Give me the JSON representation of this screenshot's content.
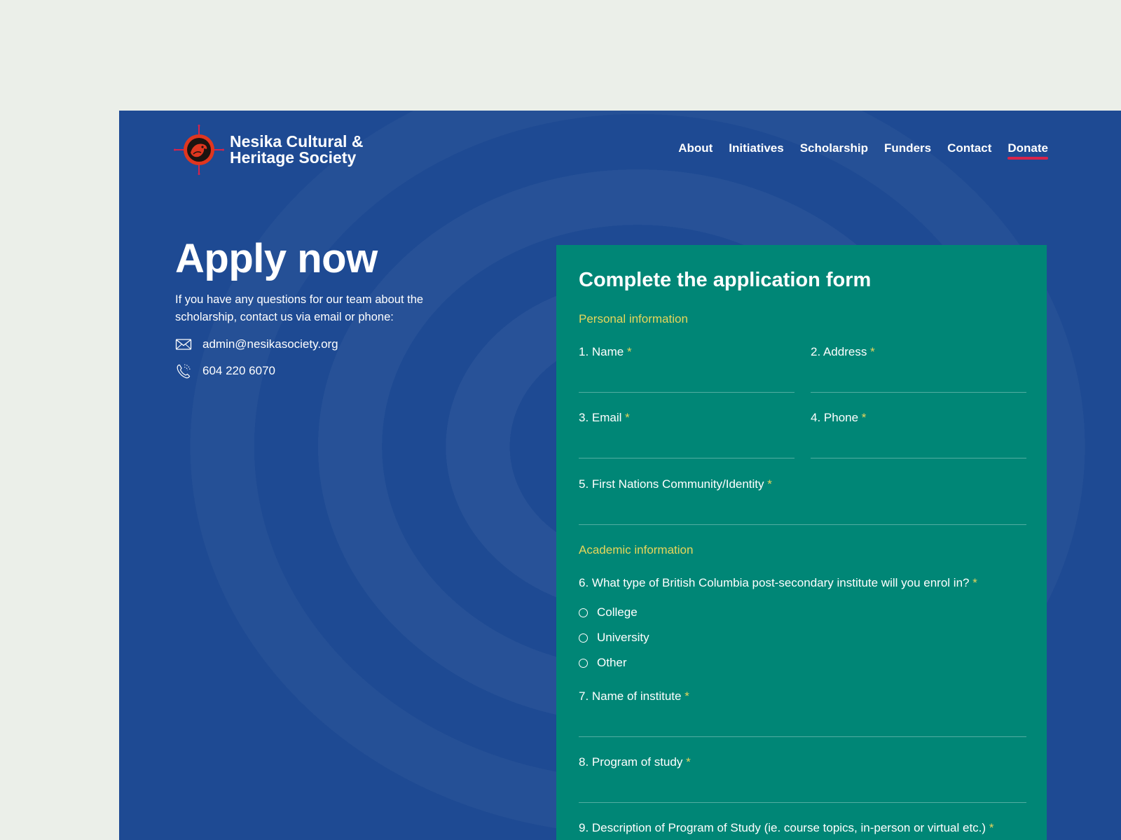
{
  "brand": {
    "name_line1": "Nesika Cultural &",
    "name_line2": "Heritage Society"
  },
  "nav": {
    "items": [
      {
        "label": "About"
      },
      {
        "label": "Initiatives"
      },
      {
        "label": "Scholarship"
      },
      {
        "label": "Funders"
      },
      {
        "label": "Contact"
      },
      {
        "label": "Donate",
        "active": true
      }
    ]
  },
  "hero": {
    "title": "Apply now",
    "intro": "If you have any questions for our team about the scholarship, contact us via email or phone:",
    "email": "admin@nesikasociety.org",
    "phone": "604 220 6070"
  },
  "form": {
    "title": "Complete the application form",
    "required_marker": "*",
    "personal_section": "Personal information",
    "academic_section": "Academic information",
    "fields": {
      "name": "1. Name",
      "address": "2. Address",
      "email": "3. Email",
      "phone": "4. Phone",
      "community": "5. First Nations Community/Identity",
      "institute_type": "6. What type of British Columbia post-secondary institute will you enrol in?",
      "institute_name": "7. Name of institute",
      "program": "8. Program of study",
      "description": "9. Description of Program of Study (ie. course topics, in-person or virtual etc.)"
    },
    "institute_options": [
      "College",
      "University",
      "Other"
    ]
  },
  "colors": {
    "page_background": "#ebefe9",
    "frame_blue": "#1e4a93",
    "form_green": "#008676",
    "accent_yellow": "#e7d65a",
    "accent_red": "#d8234a"
  },
  "icons": {
    "logo": "eagle-emblem-icon",
    "email": "envelope-icon",
    "phone": "phone-icon"
  }
}
